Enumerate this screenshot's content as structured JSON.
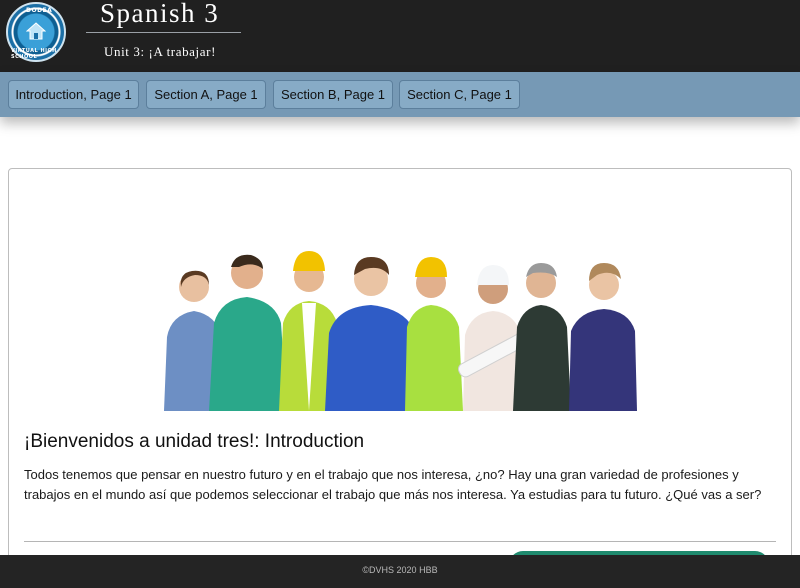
{
  "header": {
    "title": "Spanish 3",
    "subtitle": "Unit 3: ¡A trabajar!",
    "logo_top_text": "DODEA",
    "logo_bottom_text": "VIRTUAL HIGH SCHOOL"
  },
  "nav": {
    "items": [
      {
        "label": "Introduction, Page 1"
      },
      {
        "label": "Section A, Page 1"
      },
      {
        "label": "Section B, Page 1"
      },
      {
        "label": "Section C, Page 1"
      }
    ]
  },
  "content": {
    "image_icon": "group-of-workers-photo",
    "heading": "¡Bienvenidos a unidad tres!: Introduction",
    "paragraph": "Todos tenemos que pensar en nuestro futuro y en el trabajo que nos interesa, ¿no? Hay una gran variedad de profesiones y trabajos en el mundo así que podemos seleccionar el trabajo que más nos interesa.  Ya estudias para tu futuro.  ¿Qué vas a ser?"
  },
  "footer": {
    "text": "©DVHS 2020 HBB"
  },
  "colors": {
    "topbar": "#202020",
    "navbar": "#7699b5",
    "nav_button": "#87abc6",
    "footer": "#242424"
  }
}
